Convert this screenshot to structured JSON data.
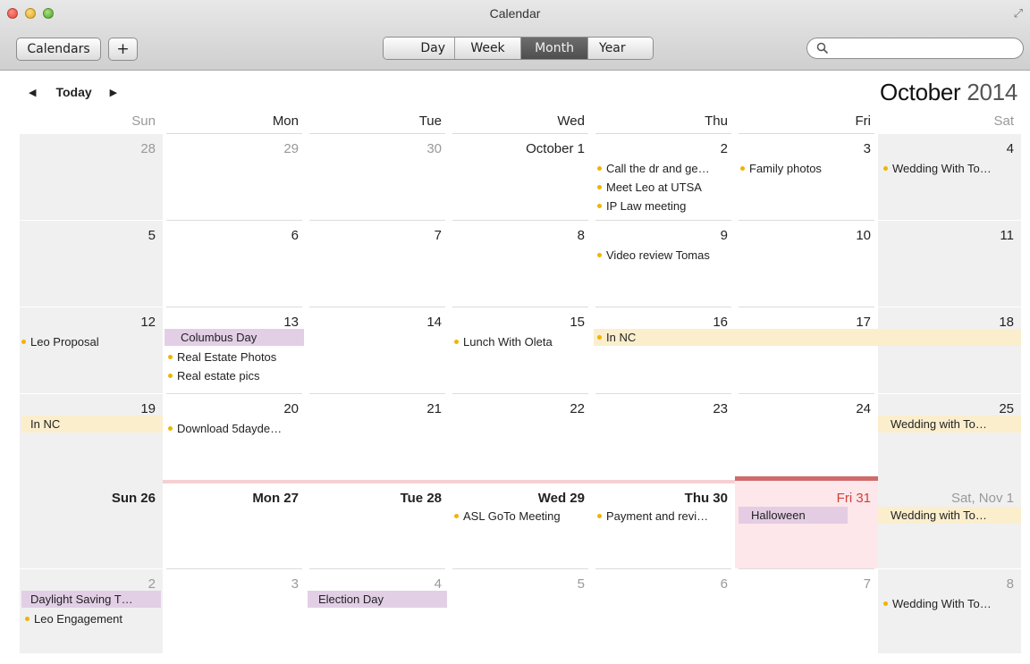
{
  "window": {
    "title": "Calendar"
  },
  "toolbar": {
    "calendars_label": "Calendars",
    "add_label": "+",
    "views": [
      "Day",
      "Week",
      "Month",
      "Year"
    ],
    "selected_view": "Month",
    "search_placeholder": ""
  },
  "nav": {
    "today_label": "Today",
    "prev_icon": "◀",
    "next_icon": "▶"
  },
  "header": {
    "month": "October",
    "year": "2014"
  },
  "weekdays": [
    "Sun",
    "Mon",
    "Tue",
    "Wed",
    "Thu",
    "Fri",
    "Sat"
  ],
  "weeks": [
    [
      "28",
      "29",
      "30",
      "October 1",
      "2",
      "3",
      "4"
    ],
    [
      "5",
      "6",
      "7",
      "8",
      "9",
      "10",
      "11"
    ],
    [
      "12",
      "13",
      "14",
      "15",
      "16",
      "17",
      "18"
    ],
    [
      "19",
      "20",
      "21",
      "22",
      "23",
      "24",
      "25"
    ],
    [
      "Sun 26",
      "Mon 27",
      "Tue 28",
      "Wed 29",
      "Thu 30",
      "Fri 31",
      "Sat, Nov 1"
    ],
    [
      "2",
      "3",
      "4",
      "5",
      "6",
      "7",
      "8"
    ]
  ],
  "events": {
    "oct2": [
      "Call the dr and ge…",
      "Meet Leo at UTSA",
      "IP Law meeting"
    ],
    "oct3": [
      "Family photos"
    ],
    "oct4": [
      "Wedding With To…"
    ],
    "oct9": [
      "Video review Tomas"
    ],
    "oct12": [
      "Leo Proposal"
    ],
    "oct13_bar": "Columbus Day",
    "oct13": [
      "Real Estate Photos",
      "Real estate pics"
    ],
    "oct15": [
      "Lunch With Oleta"
    ],
    "oct16_span": "In NC",
    "oct19_bar": "In NC",
    "oct20": [
      "Download 5dayde…"
    ],
    "oct25_bar": "Wedding with To…",
    "oct29": [
      "ASL GoTo Meeting"
    ],
    "oct30": [
      "Payment and revi…"
    ],
    "oct31_bar": "Halloween",
    "nov1_bar": "Wedding with To…",
    "nov2_bar": "Daylight Saving T…",
    "nov2": [
      "Leo Engagement"
    ],
    "nov4_bar": "Election Day",
    "nov8": [
      "Wedding With To…"
    ]
  },
  "colors": {
    "today_accent": "#d0413c",
    "event_dot": "#f0b400",
    "holiday_bar": "#e2cfe6",
    "multi_day_bar": "#fbeecd"
  }
}
